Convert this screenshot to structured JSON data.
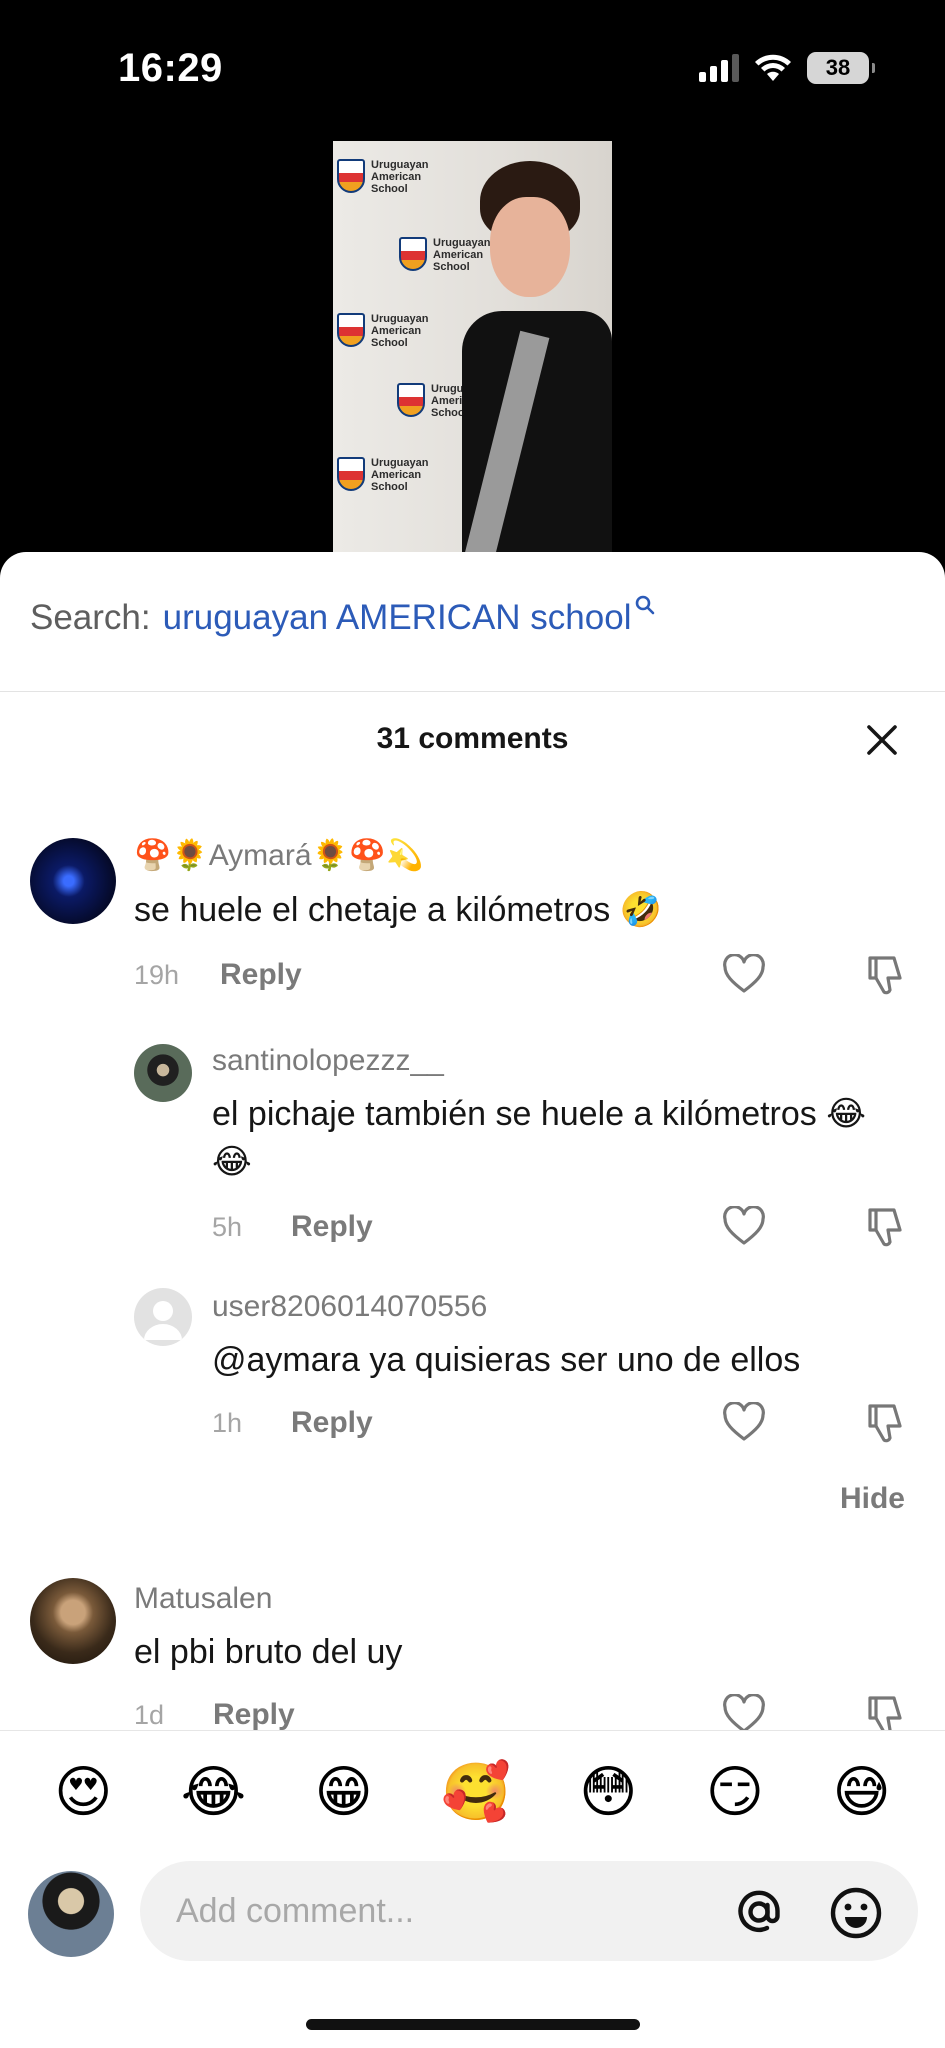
{
  "status_bar": {
    "time": "16:29",
    "battery": "38"
  },
  "video_frame": {
    "backdrop_text": [
      "Uruguayan",
      "American",
      "School"
    ]
  },
  "search": {
    "label": "Search:",
    "query": "uruguayan AMERICAN school"
  },
  "comments_header": {
    "title": "31 comments"
  },
  "comments": [
    {
      "name_prefix": "🍄🌻",
      "name": "Aymará",
      "name_suffix": "🌻🍄💫",
      "text": "se huele el chetaje a kilómetros 🤣",
      "time": "19h",
      "reply_label": "Reply"
    },
    {
      "name": "santinolopezzz__",
      "text": "el pichaje también se huele a kilómetros 😂😂",
      "time": "5h",
      "reply_label": "Reply"
    },
    {
      "name": "user8206014070556",
      "text": "@aymara ya quisieras ser uno de ellos",
      "time": "1h",
      "reply_label": "Reply"
    },
    {
      "name": "Matusalen",
      "text": "el pbi bruto del uy",
      "time": "1d",
      "reply_label": "Reply"
    }
  ],
  "hide_label": "Hide",
  "emoji_bar": [
    "😍",
    "😂",
    "😁",
    "🥰",
    "😳",
    "😏",
    "😅"
  ],
  "composer": {
    "placeholder": "Add comment..."
  },
  "colors": {
    "link_blue": "#2c5bb8",
    "muted": "#7a7a7a"
  },
  "icons": [
    "signal-icon",
    "wifi-icon",
    "battery-icon",
    "search-icon",
    "close-icon",
    "heart-icon",
    "dislike-icon",
    "at-icon",
    "emoji-icon"
  ]
}
